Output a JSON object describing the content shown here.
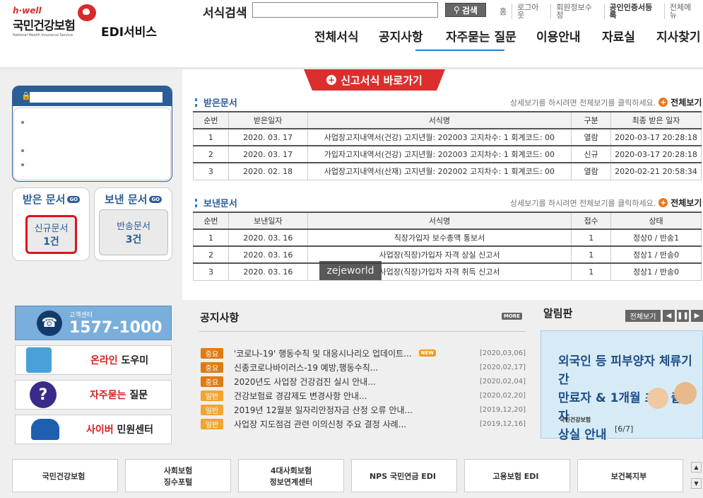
{
  "header": {
    "logo_hwell": "h·well",
    "logo_main": "국민건강보험",
    "logo_sub": "National Health Insurance Service",
    "service_name": "EDI서비스",
    "search_label": "서식검색",
    "search_button": "검색",
    "util_links": [
      "홈",
      "로그아웃",
      "회원정보수정",
      "공인인증서등록",
      "전체메뉴"
    ],
    "nav": [
      "전체서식",
      "공지사항",
      "자주묻는 질문",
      "이용안내",
      "자료실",
      "지사찾기"
    ]
  },
  "shortcut_label": "신고서식 바로가기",
  "left": {
    "received_title": "받은 문서",
    "sent_title": "보낸 문서",
    "go": "GO",
    "new_docs_label": "신규문서",
    "new_docs_count": "1건",
    "returned_label": "반송문서",
    "returned_count": "3건"
  },
  "received": {
    "title": "받은문서",
    "hint": "상세보기를 하시려면 전체보기를 클릭하세요.",
    "view_all": "전체보기",
    "headers": [
      "순번",
      "받은일자",
      "서식명",
      "구분",
      "최종 받은 일자"
    ],
    "rows": [
      [
        "1",
        "2020. 03. 17",
        "사업장고지내역서(건강) 고지년월: 202003 고지차수: 1 회계코드: 00",
        "열람",
        "2020-03-17 20:28:18"
      ],
      [
        "2",
        "2020. 03. 17",
        "가입자고지내역서(건강) 고지년월: 202003 고지차수: 1 회계코드: 00",
        "신규",
        "2020-03-17 20:28:18"
      ],
      [
        "3",
        "2020. 02. 18",
        "사업장고지내역서(산재) 고지년월: 202002 고지차수: 1 회계코드: 00",
        "열람",
        "2020-02-21 20:58:34"
      ]
    ]
  },
  "sent": {
    "title": "보낸문서",
    "hint": "상세보기를 하시려면 전체보기를 클릭하세요.",
    "view_all": "전체보기",
    "headers": [
      "순번",
      "보낸일자",
      "서식명",
      "접수",
      "상태"
    ],
    "rows": [
      [
        "1",
        "2020. 03. 16",
        "직장가입자 보수총액 통보서",
        "1",
        "정상0 / 반송1"
      ],
      [
        "2",
        "2020. 03. 16",
        "사업장(직장)가입자 자격 상실 신고서",
        "1",
        "정상1 / 반송0"
      ],
      [
        "3",
        "2020. 03. 16",
        "사업장(직장)가입자 자격 취득 신고서",
        "1",
        "정상1 / 반송0"
      ]
    ]
  },
  "customer_center": {
    "label": "고객센터",
    "number": "1577-1000"
  },
  "side_menu": [
    {
      "red": "온라인",
      "black": " 도우미"
    },
    {
      "red": "자주묻는",
      "black": " 질문"
    },
    {
      "red": "사이버",
      "black": " 민원센터"
    }
  ],
  "notice": {
    "title": "공지사항",
    "more": "MORE",
    "new_badge": "NEW",
    "items": [
      {
        "tag": "중요",
        "text": "'코로나-19' 행동수칙 및 대응시나리오 업데이트...",
        "date": "[2020,03,06]"
      },
      {
        "tag": "중요",
        "text": "신종코로나바이러스-19 예방,행동수칙...",
        "date": "[2020,02,17]"
      },
      {
        "tag": "중요",
        "text": "2020년도 사업장 건강검진 실시 안내...",
        "date": "[2020,02,04]"
      },
      {
        "tag": "일반",
        "text": "건강보험료 경감제도 변경사항 안내...",
        "date": "[2020,02,20]"
      },
      {
        "tag": "일반",
        "text": "2019년 12월분 일자리안정자금 산정 오류 안내...",
        "date": "[2019,12,20]"
      },
      {
        "tag": "일반",
        "text": "사업장 지도점검 관련 이의신청 주요 결정 사례...",
        "date": "[2019,12,16]"
      }
    ]
  },
  "alarm": {
    "title": "알림판",
    "view_all": "전체보기",
    "banner_line1": "외국인 등 피부양자 체류기간",
    "banner_line2": "만료자 & 1개월 초과 출국자",
    "banner_line3": "상실 안내",
    "banner_logo": "국민건강보험",
    "page": "[6/7]"
  },
  "footer_logos": [
    {
      "line1": "국민건강보험",
      "line2": ""
    },
    {
      "line1": "사회보험",
      "line2": "징수포털"
    },
    {
      "line1": "4대사회보험",
      "line2": "정보연계센터"
    },
    {
      "line1": "NPS 국민연금 EDI",
      "line2": ""
    },
    {
      "line1": "고용보험 EDI",
      "line2": ""
    },
    {
      "line1": "보건복지부",
      "line2": ""
    }
  ],
  "watermark": "zejeworld",
  "colors": {
    "brand_blue": "#2b5d97",
    "red": "#dd2e2e",
    "orange": "#e07b14"
  }
}
